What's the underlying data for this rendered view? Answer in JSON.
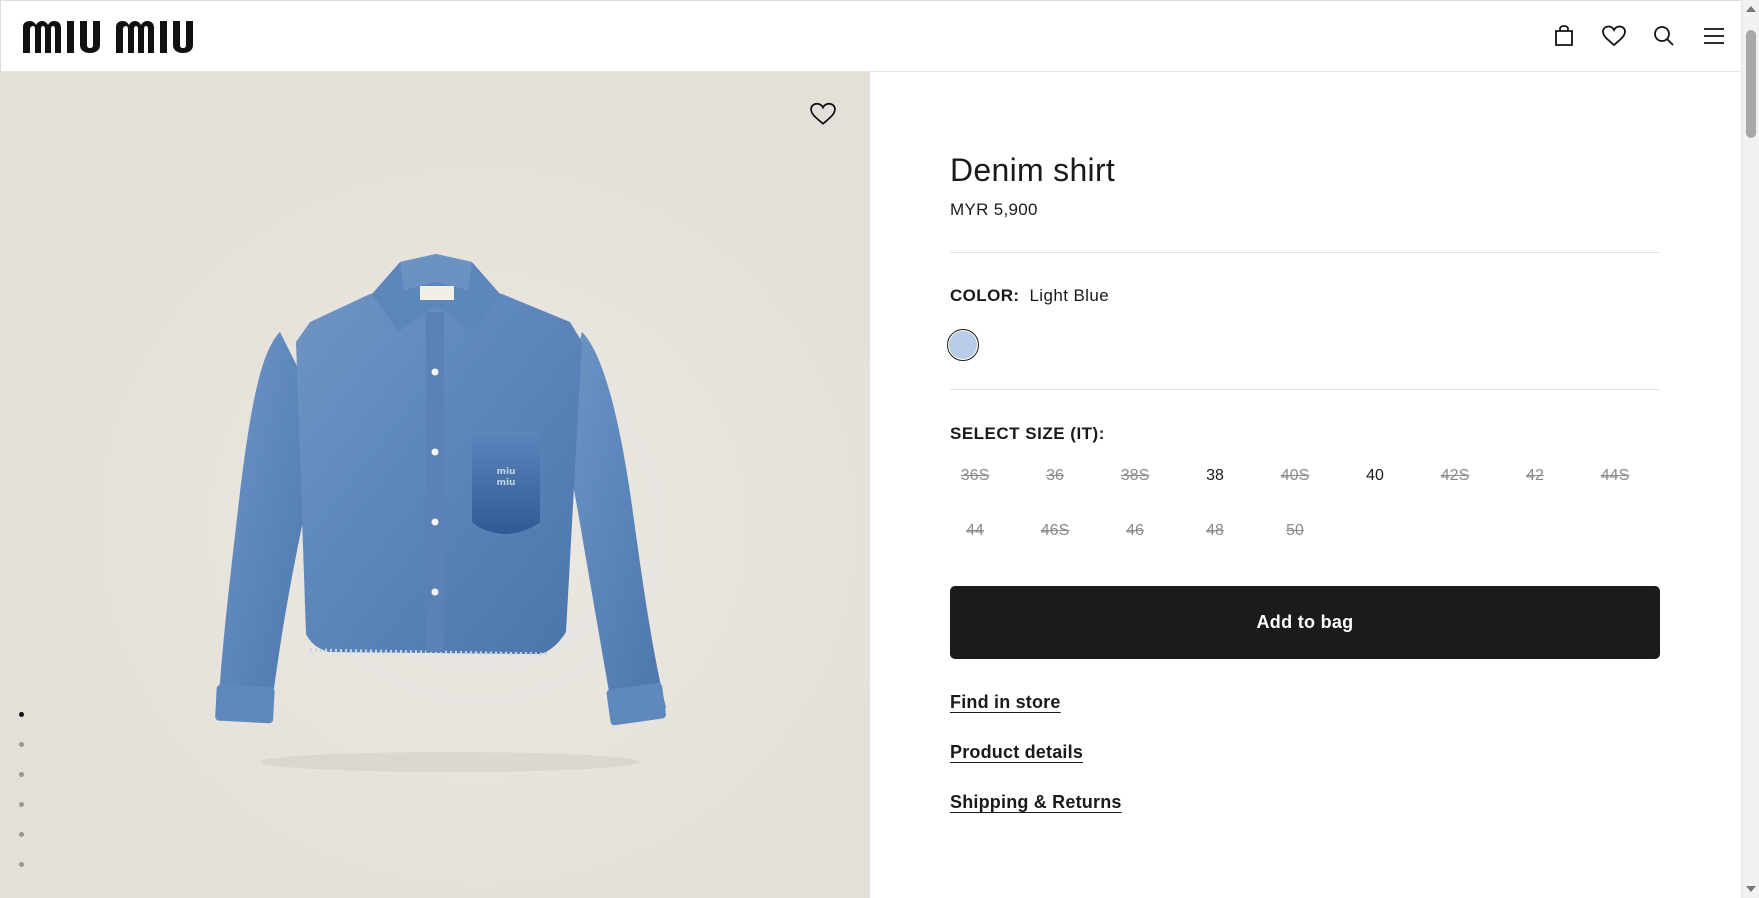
{
  "header": {
    "logo": "miu miu",
    "icons": [
      "bag-icon",
      "heart-icon",
      "search-icon",
      "menu-icon"
    ]
  },
  "gallery": {
    "image_alt": "Denim shirt",
    "dots_count": 6,
    "active_dot": 0,
    "background_color": "#e7e2dc"
  },
  "product": {
    "title": "Denim shirt",
    "price": "MYR 5,900",
    "color_label": "COLOR:",
    "color_value": "Light Blue",
    "swatch_color": "#b9cde8",
    "size_label": "SELECT SIZE (IT):",
    "sizes": [
      {
        "label": "36S",
        "available": false
      },
      {
        "label": "36",
        "available": false
      },
      {
        "label": "38S",
        "available": false
      },
      {
        "label": "38",
        "available": true
      },
      {
        "label": "40S",
        "available": false
      },
      {
        "label": "40",
        "available": true
      },
      {
        "label": "42S",
        "available": false
      },
      {
        "label": "42",
        "available": false
      },
      {
        "label": "44S",
        "available": false
      },
      {
        "label": "44",
        "available": false
      },
      {
        "label": "46S",
        "available": false
      },
      {
        "label": "46",
        "available": false
      },
      {
        "label": "48",
        "available": false
      },
      {
        "label": "50",
        "available": false
      }
    ],
    "add_to_bag": "Add to bag",
    "links": {
      "find_in_store": "Find in store",
      "product_details": "Product details",
      "shipping_returns": "Shipping & Returns"
    }
  }
}
